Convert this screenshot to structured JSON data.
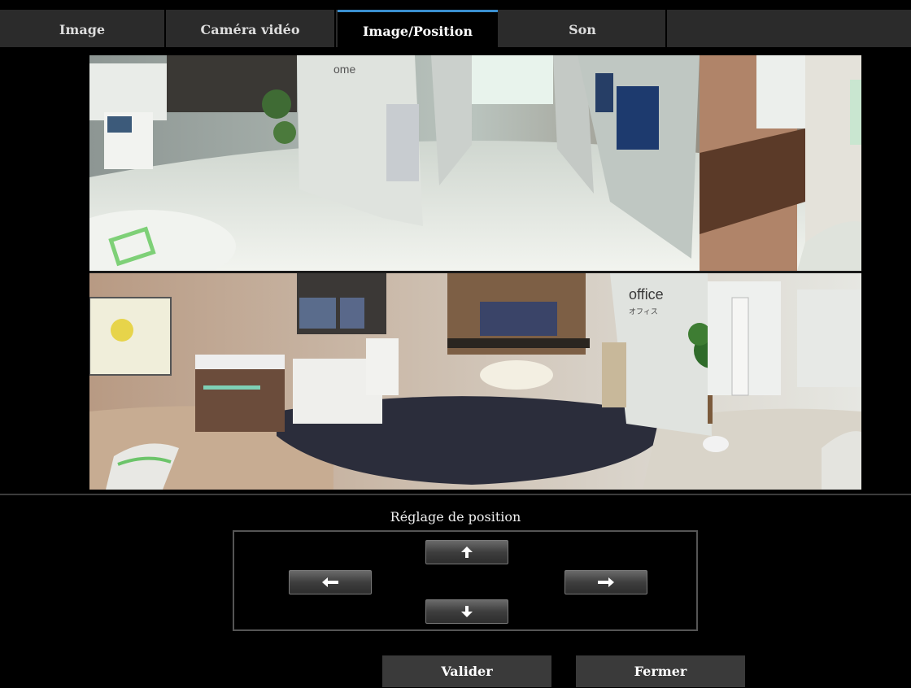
{
  "tabs": [
    {
      "label": "Image",
      "active": false
    },
    {
      "label": "Caméra vidéo",
      "active": false
    },
    {
      "label": "Image/Position",
      "active": true
    },
    {
      "label": "Son",
      "active": false
    }
  ],
  "camera": {
    "top_signage": "ome",
    "bottom_signage_title": "office",
    "bottom_signage_subtitle": "オフィス"
  },
  "position": {
    "title": "Réglage de position",
    "up_icon": "arrow-up-icon",
    "down_icon": "arrow-down-icon",
    "left_icon": "arrow-left-icon",
    "right_icon": "arrow-right-icon"
  },
  "actions": {
    "validate_label": "Valider",
    "close_label": "Fermer"
  },
  "colors": {
    "background": "#000000",
    "tab_bg": "#2b2b2b",
    "active_tab_accent": "#3a8fd0",
    "button_bg": "#3a3a3a"
  }
}
